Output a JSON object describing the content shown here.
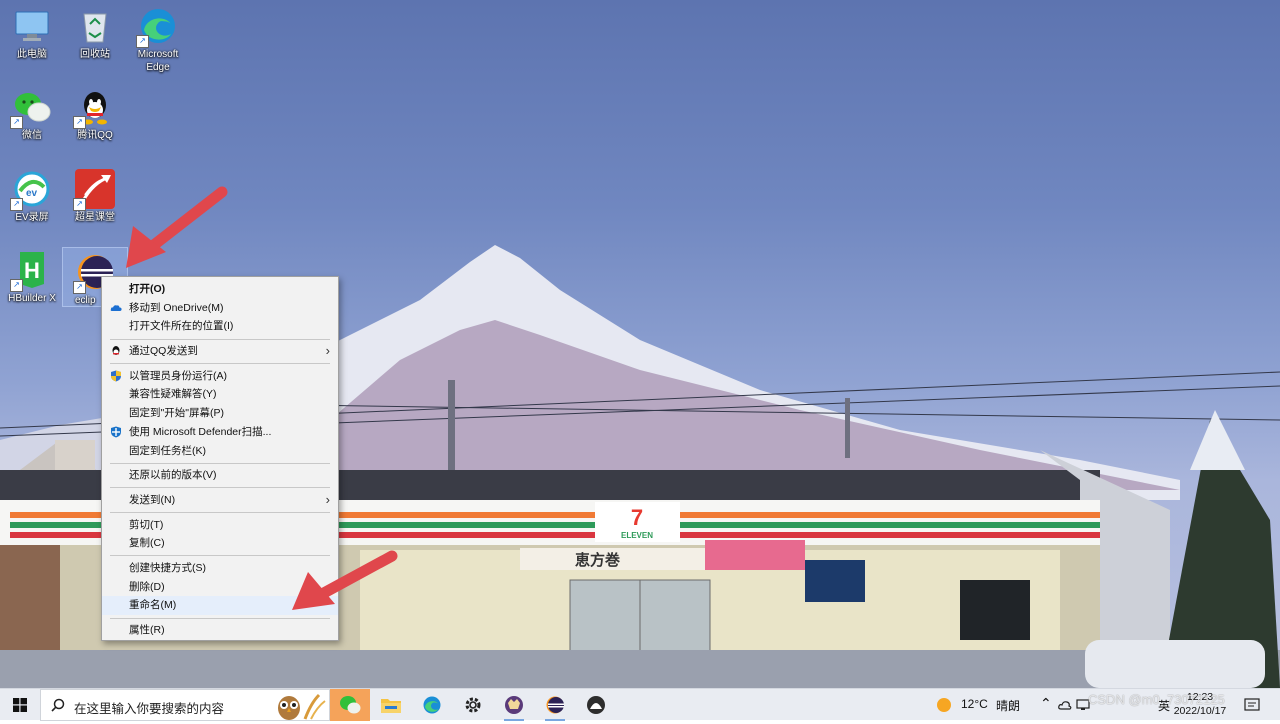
{
  "desktop": {
    "icons": [
      {
        "label": "此电脑",
        "icon": "computer-icon"
      },
      {
        "label": "回收站",
        "icon": "recycle-bin-icon"
      },
      {
        "label": "Microsoft Edge",
        "icon": "edge-icon"
      },
      {
        "label": "微信",
        "icon": "wechat-icon"
      },
      {
        "label": "腾讯QQ",
        "icon": "qq-icon"
      },
      {
        "label": "EV录屏",
        "icon": "ev-recorder-icon"
      },
      {
        "label": "超星课堂",
        "icon": "chaoxing-icon"
      },
      {
        "label": "HBuilder X",
        "icon": "hbuilder-icon"
      },
      {
        "label": "eclip",
        "icon": "eclipse-icon"
      }
    ]
  },
  "context_menu": {
    "items": [
      {
        "label": "打开(O)"
      },
      {
        "label": "移动到 OneDrive(M)"
      },
      {
        "label": "打开文件所在的位置(I)"
      },
      {
        "label": "通过QQ发送到"
      },
      {
        "label": "以管理员身份运行(A)"
      },
      {
        "label": "兼容性疑难解答(Y)"
      },
      {
        "label": "固定到\"开始\"屏幕(P)"
      },
      {
        "label": "使用 Microsoft Defender扫描..."
      },
      {
        "label": "固定到任务栏(K)"
      },
      {
        "label": "还原以前的版本(V)"
      },
      {
        "label": "发送到(N)"
      },
      {
        "label": "剪切(T)"
      },
      {
        "label": "复制(C)"
      },
      {
        "label": "创建快捷方式(S)"
      },
      {
        "label": "删除(D)"
      },
      {
        "label": "重命名(M)"
      },
      {
        "label": "属性(R)"
      }
    ]
  },
  "wallpaper": {
    "store_sign": "ELEVEN",
    "banner_text": "恵方巻"
  },
  "taskbar": {
    "search_placeholder": "在这里输入你要搜索的内容",
    "weather_temp": "12°C",
    "weather_desc": "晴朗",
    "input_method": "英",
    "clock_time": "12:23",
    "clock_date": "2022/10/17",
    "watermark": "CSDN @m0_73072125"
  },
  "colors": {
    "accent_arrow": "#e0474c",
    "taskbar_active": "#f5a35a",
    "menu_bg": "#f2f2f2"
  }
}
